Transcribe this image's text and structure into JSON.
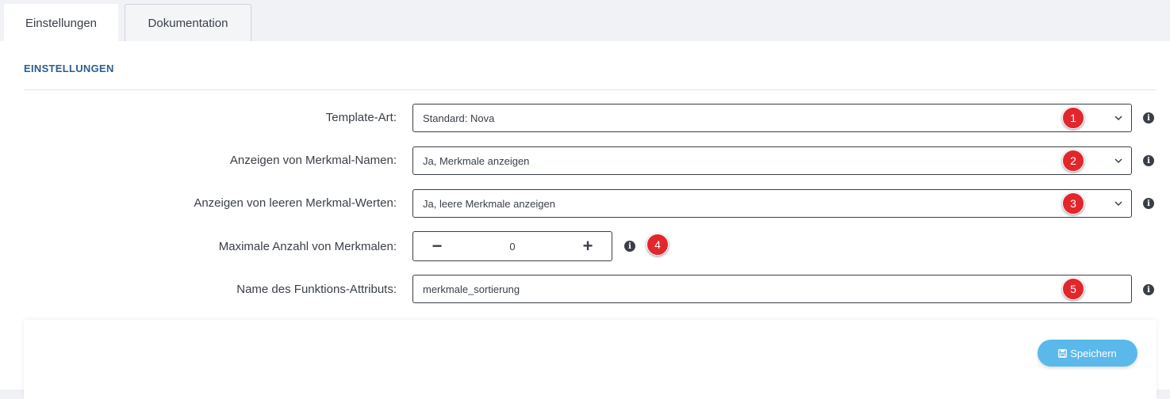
{
  "tabs": [
    {
      "label": "Einstellungen",
      "active": true
    },
    {
      "label": "Dokumentation",
      "active": false
    }
  ],
  "section_title": "EINSTELLUNGEN",
  "fields": {
    "template_art": {
      "label": "Template-Art:",
      "value": "Standard: Nova",
      "badge": "1"
    },
    "merkmal_namen": {
      "label": "Anzeigen von Merkmal-Namen:",
      "value": "Ja, Merkmale anzeigen",
      "badge": "2"
    },
    "leere_werte": {
      "label": "Anzeigen von leeren Merkmal-Werten:",
      "value": "Ja, leere Merkmale anzeigen",
      "badge": "3"
    },
    "max_anzahl": {
      "label": "Maximale Anzahl von Merkmalen:",
      "value": "0",
      "minus": "−",
      "plus": "+",
      "badge": "4"
    },
    "funktions_attribut": {
      "label": "Name des Funktions-Attributs:",
      "value": "merkmale_sortierung",
      "badge": "5"
    }
  },
  "info_glyph": "i",
  "save_button": {
    "label": "Speichern",
    "icon": "save-icon"
  },
  "colors": {
    "badge": "#e3262b",
    "save_button": "#5bb8ea",
    "section_title": "#2f5d8a"
  }
}
